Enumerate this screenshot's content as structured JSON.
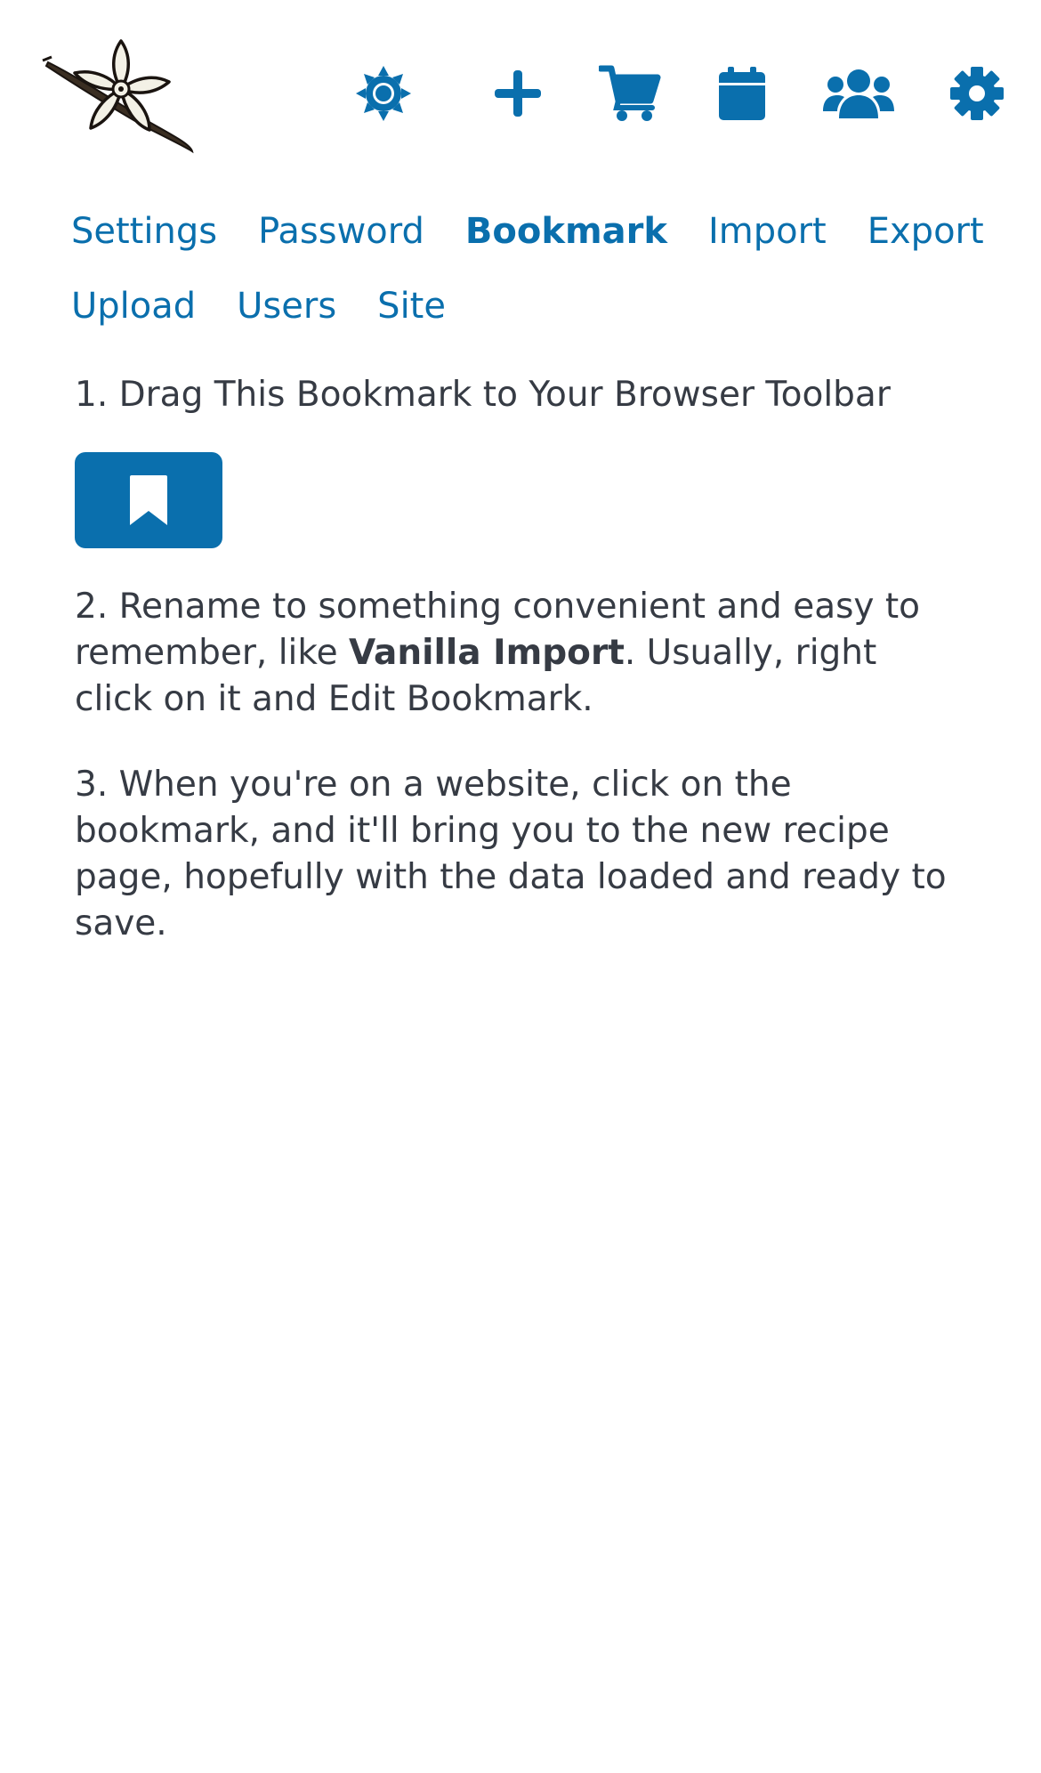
{
  "header": {
    "icons": [
      {
        "name": "sun-icon",
        "label": "Theme"
      },
      {
        "name": "plus-icon",
        "label": "New recipe"
      },
      {
        "name": "cart-icon",
        "label": "Shopping list"
      },
      {
        "name": "calendar-icon",
        "label": "Meal plan"
      },
      {
        "name": "users-icon",
        "label": "Cook books"
      },
      {
        "name": "gear-icon",
        "label": "Settings"
      }
    ],
    "accent_color": "#0a6fad"
  },
  "subnav": {
    "items": [
      {
        "label": "Settings",
        "active": false
      },
      {
        "label": "Password",
        "active": false
      },
      {
        "label": "Bookmark",
        "active": true
      },
      {
        "label": "Import",
        "active": false
      },
      {
        "label": "Export",
        "active": false
      },
      {
        "label": "Upload",
        "active": false
      },
      {
        "label": "Users",
        "active": false
      },
      {
        "label": "Site",
        "active": false
      }
    ]
  },
  "content": {
    "step1": "1. Drag This Bookmark to Your Browser Toolbar",
    "bookmark_icon": "bookmark-icon",
    "step2_pre": "2. Rename to something convenient and easy to remember, like ",
    "step2_bold": "Vanilla Import",
    "step2_post": ". Usually, right click on it and Edit Bookmark.",
    "step3": "3. When you're on a website, click on the bookmark, and it'll bring you to the new recipe page, hopefully with the data loaded and ready to save."
  }
}
